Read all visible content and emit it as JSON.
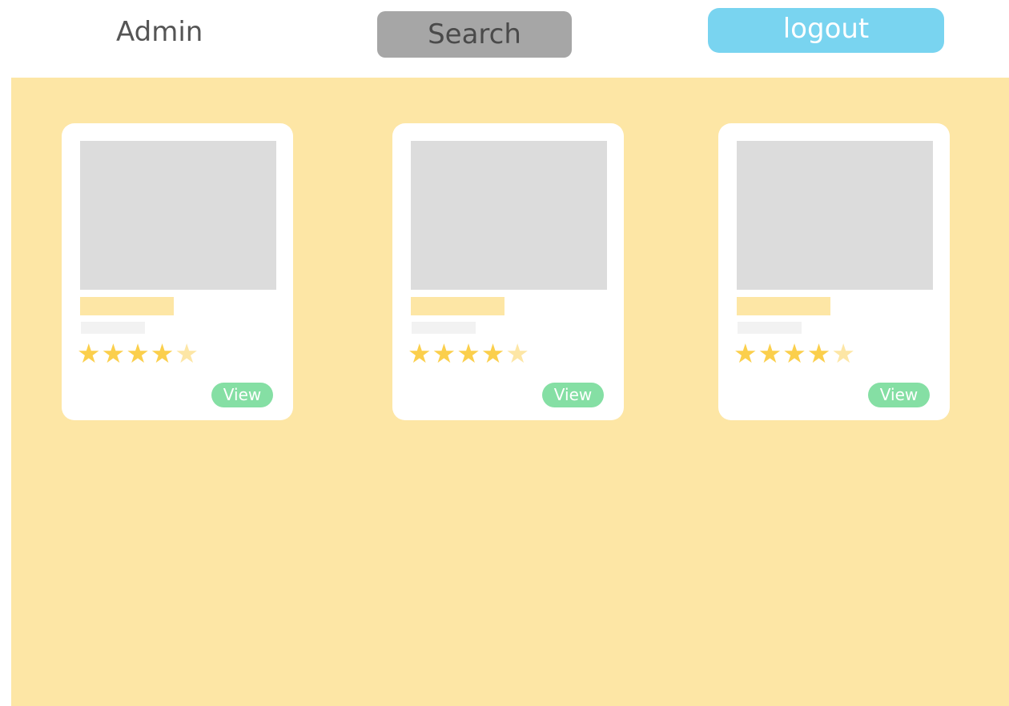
{
  "header": {
    "admin_label": "Admin",
    "search_label": "Search",
    "logout_label": "logout"
  },
  "cards": [
    {
      "rating": 4,
      "max_rating": 5,
      "view_label": "View"
    },
    {
      "rating": 4,
      "max_rating": 5,
      "view_label": "View"
    },
    {
      "rating": 4,
      "max_rating": 5,
      "view_label": "View"
    }
  ],
  "icons": {
    "full_star": "★",
    "empty_star": "★"
  },
  "colors": {
    "background": "#fde6a5",
    "search_button": "#a6a6a6",
    "logout_button": "#79d4f0",
    "view_button": "#85dfa4",
    "star_full": "#fbcf4c",
    "star_empty": "#fde6a5",
    "image_placeholder": "#dcdcdc"
  }
}
